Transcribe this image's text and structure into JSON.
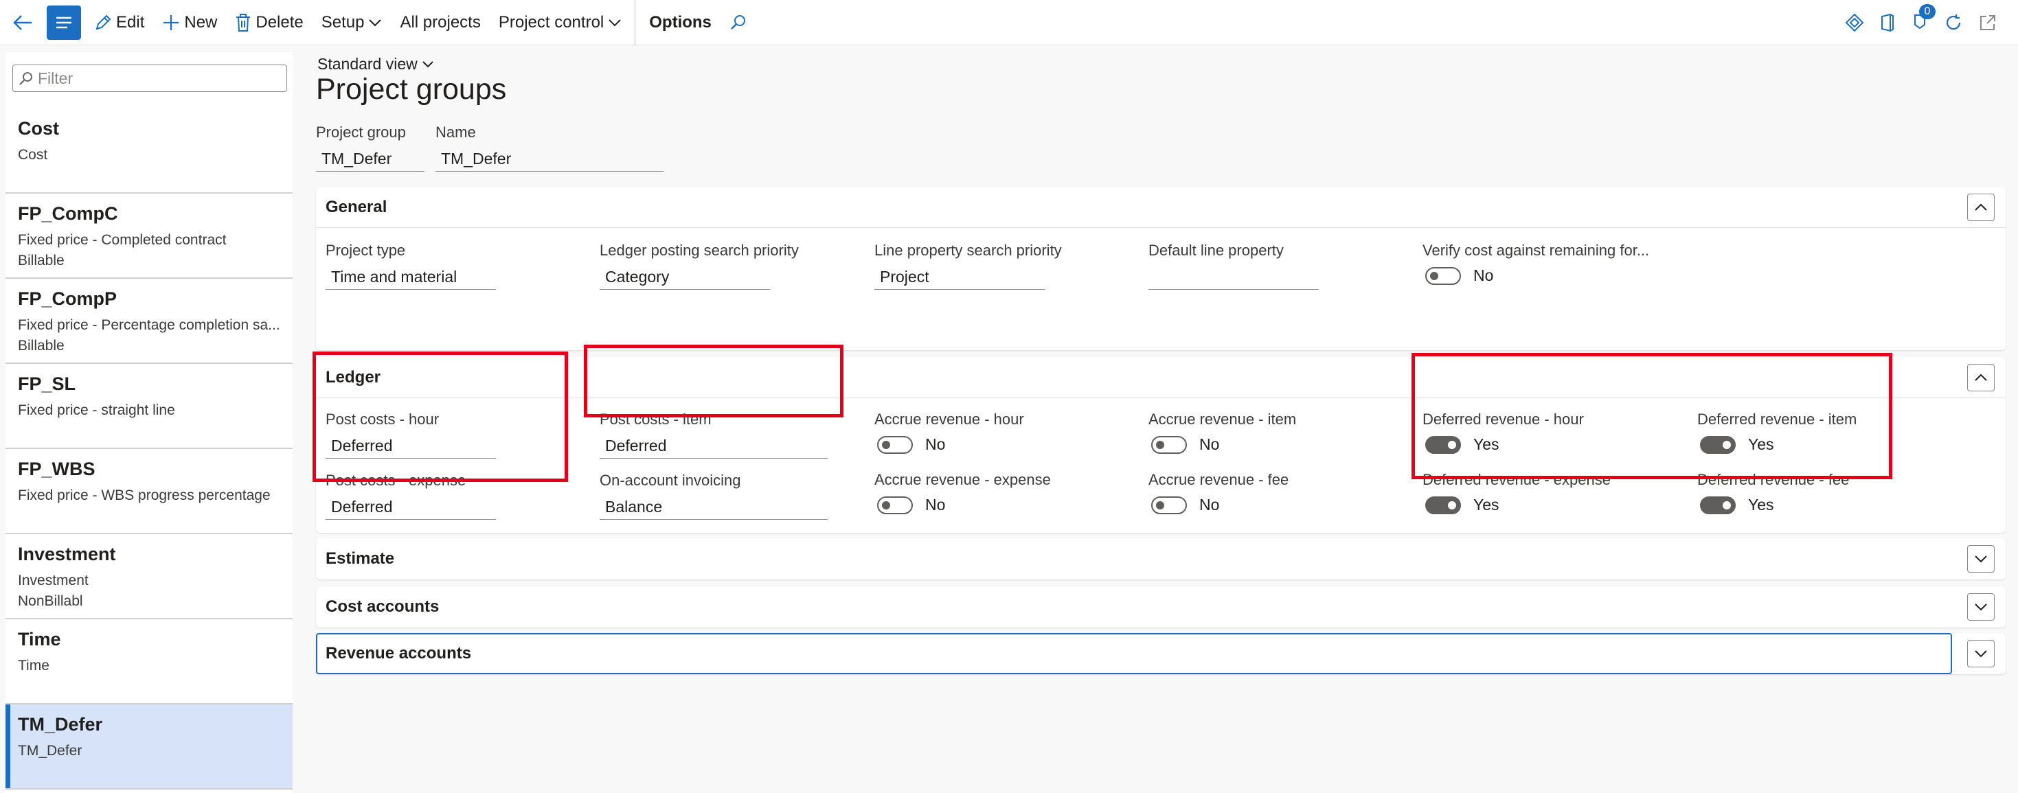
{
  "toolbar": {
    "edit": "Edit",
    "new": "New",
    "delete": "Delete",
    "setup": "Setup",
    "all_projects": "All projects",
    "project_control": "Project control",
    "options": "Options",
    "notification_count": "0",
    "accent": "#1b6ec2"
  },
  "list": {
    "filter_placeholder": "Filter",
    "items": [
      {
        "title": "Cost",
        "line1": "Cost",
        "line2": ""
      },
      {
        "title": "FP_CompC",
        "line1": "Fixed price - Completed contract",
        "line2": "Billable"
      },
      {
        "title": "FP_CompP",
        "line1": "Fixed price - Percentage completion sa...",
        "line2": "Billable"
      },
      {
        "title": "FP_SL",
        "line1": "Fixed price - straight line",
        "line2": ""
      },
      {
        "title": "FP_WBS",
        "line1": "Fixed price - WBS progress percentage",
        "line2": ""
      },
      {
        "title": "Investment",
        "line1": "Investment",
        "line2": "NonBillabl"
      },
      {
        "title": "Time",
        "line1": "Time",
        "line2": ""
      },
      {
        "title": "TM_Defer",
        "line1": "TM_Defer",
        "line2": ""
      }
    ],
    "selected": "TM_Defer"
  },
  "main": {
    "view": "Standard view",
    "title": "Project groups",
    "project_group_label": "Project group",
    "project_group_value": "TM_Defer",
    "name_label": "Name",
    "name_value": "TM_Defer"
  },
  "general": {
    "heading": "General",
    "project_type": {
      "label": "Project type",
      "value": "Time and material"
    },
    "ledger_priority": {
      "label": "Ledger posting search priority",
      "value": "Category"
    },
    "line_priority": {
      "label": "Line property search priority",
      "value": "Project"
    },
    "default_line": {
      "label": "Default line property",
      "value": ""
    },
    "verify_cost": {
      "label": "Verify cost against remaining for...",
      "value": "No"
    }
  },
  "ledger": {
    "heading": "Ledger",
    "post_costs_hour": {
      "label": "Post costs - hour",
      "value": "Deferred"
    },
    "post_costs_expense": {
      "label": "Post costs - expense",
      "value": "Deferred"
    },
    "post_costs_item": {
      "label": "Post costs - item",
      "value": "Deferred"
    },
    "on_account": {
      "label": "On-account invoicing",
      "value": "Balance"
    },
    "accrue_hour": {
      "label": "Accrue revenue - hour",
      "value": "No"
    },
    "accrue_expense": {
      "label": "Accrue revenue - expense",
      "value": "No"
    },
    "accrue_item": {
      "label": "Accrue revenue - item",
      "value": "No"
    },
    "accrue_fee": {
      "label": "Accrue revenue - fee",
      "value": "No"
    },
    "deferred_hour": {
      "label": "Deferred revenue - hour",
      "value": "Yes"
    },
    "deferred_expense": {
      "label": "Deferred revenue - expense",
      "value": "Yes"
    },
    "deferred_item": {
      "label": "Deferred revenue - item",
      "value": "Yes"
    },
    "deferred_fee": {
      "label": "Deferred revenue - fee",
      "value": "Yes"
    }
  },
  "sections": {
    "estimate": "Estimate",
    "cost_accounts": "Cost accounts",
    "revenue_accounts": "Revenue accounts"
  },
  "highlight_color": "#e3001b"
}
